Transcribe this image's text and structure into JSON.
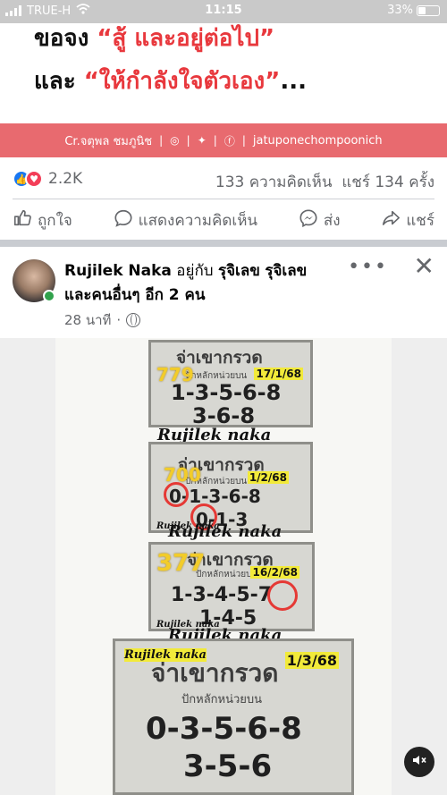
{
  "status_bar": {
    "carrier": "TRUE-H",
    "time": "11:15",
    "battery": "33%",
    "battery_level": 0.33
  },
  "banner": {
    "line1_prefix": "ขอจง ",
    "line1_quote": "“สู้ และอยู่ต่อไป”",
    "line2_prefix": "และ ",
    "line2_quote": "“ให้กำลังใจตัวเอง”",
    "line2_suffix": "...",
    "credit_name": "Cr.จตุพล ชมภูนิช",
    "credit_handle": "jatuponechompoonich",
    "accent_color": "#e8383d"
  },
  "reactions": {
    "count": "2.2K",
    "comments": "133 ความคิดเห็น",
    "shares": "แชร์ 134 ครั้ง"
  },
  "actions": {
    "like": "ถูกใจ",
    "comment": "แสดงความคิดเห็น",
    "send": "ส่ง",
    "share": "แชร์"
  },
  "post": {
    "author": "Rujilek Naka",
    "with_text": " อยู่กับ ",
    "tag1": "รุจิเลข",
    "tag2": "รุจิเลข",
    "and_text": "และคนอื่นๆ อีก 2 คน",
    "time": "28 นาที",
    "dot": "·"
  },
  "image": {
    "tickets": [
      {
        "yellow": "779",
        "title": "จ่าเขากรวด",
        "sub": "ปักหลักหน่วยบน",
        "date": "17/1/68",
        "row1": "1-3-5-6-8",
        "row2": "3-6-8"
      },
      {
        "yellow": "700",
        "title": "จ่าเขากรวด",
        "sub": "ปักหลักหน่วยบน",
        "date": "1/2/68",
        "row1": "0-1-3-6-8",
        "row2": "0-1-3"
      },
      {
        "yellow": "377",
        "title": "จ่าเขากรวด",
        "sub": "ปักหลักหน่วยบน",
        "date": "16/2/68",
        "row1": "1-3-4-5-7",
        "row2": "1-4-5"
      },
      {
        "yellow": "",
        "title": "จ่าเขากรวด",
        "sub": "ปักหลักหน่วยบน",
        "date": "1/3/68",
        "row1": "0-3-5-6-8",
        "row2": "3-5-6"
      }
    ],
    "signature": "Rujilek naka",
    "signature_small": "Rujilek naka"
  }
}
